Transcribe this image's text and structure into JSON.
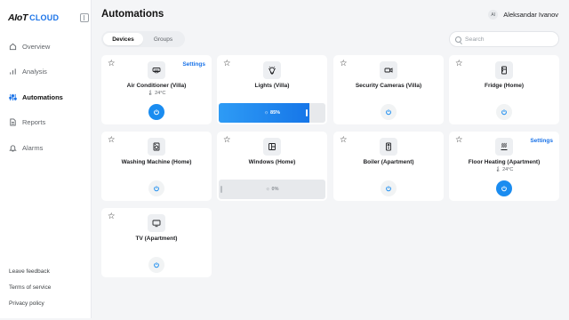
{
  "brand": {
    "logo_mark": "AIoT",
    "logo_text": "CLOUD"
  },
  "nav": [
    {
      "label": "Overview",
      "icon": "home-icon",
      "active": false
    },
    {
      "label": "Analysis",
      "icon": "bar-chart-icon",
      "active": false
    },
    {
      "label": "Automations",
      "icon": "sliders-icon",
      "active": true
    },
    {
      "label": "Reports",
      "icon": "document-icon",
      "active": false
    },
    {
      "label": "Alarms",
      "icon": "bell-icon",
      "active": false
    }
  ],
  "footer": [
    "Leave feedback",
    "Terms of service",
    "Privacy policy"
  ],
  "page": {
    "title": "Automations"
  },
  "user": {
    "initials": "AI",
    "name": "Aleksandar Ivanov"
  },
  "tabs": [
    {
      "label": "Devices",
      "active": true
    },
    {
      "label": "Groups",
      "active": false
    }
  ],
  "search": {
    "placeholder": "Search",
    "value": ""
  },
  "colors": {
    "accent": "#1a8cf0",
    "link": "#1a73e8"
  },
  "devices": [
    {
      "name": "Air Conditioner (Villa)",
      "icon": "air-conditioner-icon",
      "settings": "Settings",
      "temp": "🌡 24°C",
      "power_on": true
    },
    {
      "name": "Lights (Villa)",
      "icon": "lightbulb-icon",
      "brightness": "85%",
      "level": 0.85
    },
    {
      "name": "Security Cameras (Villa)",
      "icon": "video-camera-icon",
      "power_on": false
    },
    {
      "name": "Fridge (Home)",
      "icon": "fridge-icon",
      "power_on": false
    },
    {
      "name": "Washing Machine (Home)",
      "icon": "washing-machine-icon",
      "power_on": false
    },
    {
      "name": "Windows (Home)",
      "icon": "window-icon",
      "brightness": "0%",
      "level": 0.0
    },
    {
      "name": "Boiler (Apartment)",
      "icon": "boiler-icon",
      "power_on": false
    },
    {
      "name": "Floor Heating (Apartment)",
      "icon": "heat-waves-icon",
      "settings": "Settings",
      "temp": "🌡 24°C",
      "power_on": true
    },
    {
      "name": "TV (Apartment)",
      "icon": "tv-icon",
      "power_on": false
    }
  ]
}
